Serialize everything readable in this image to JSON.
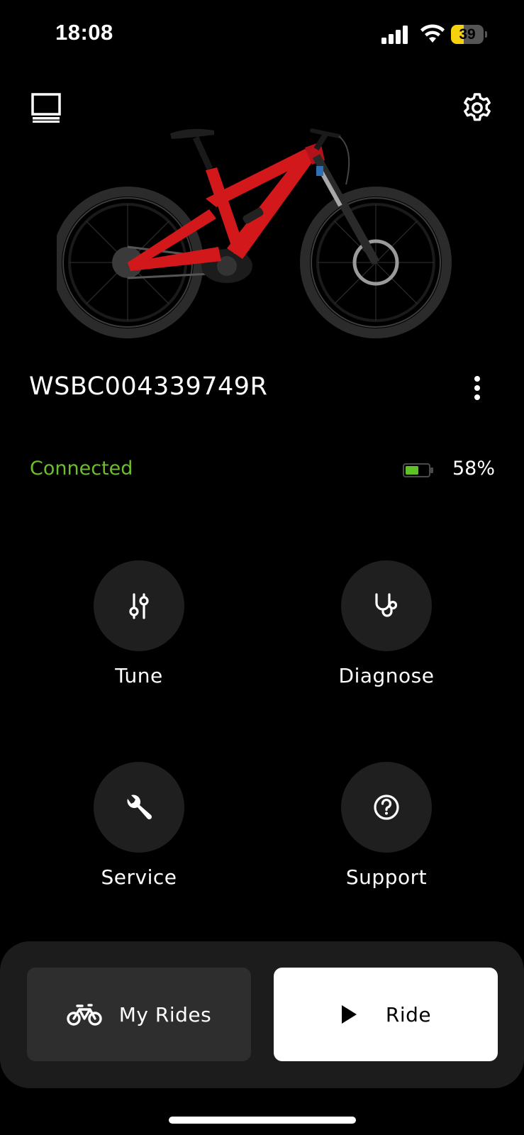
{
  "status_bar": {
    "time": "18:08",
    "battery_level": "39",
    "battery_fraction": 0.39,
    "icons": [
      "signal-icon",
      "wifi-icon",
      "battery-icon"
    ]
  },
  "header": {
    "left_icon": "garage-icon",
    "right_icon": "gear-icon"
  },
  "bike": {
    "name": "WSBC004339749R",
    "image": "red-mountain-bike",
    "brand_color": "#d3181c"
  },
  "connection": {
    "status": "Connected",
    "status_color": "#6ebd2c",
    "battery_percent_label": "58%",
    "battery_fraction": 0.58
  },
  "actions": [
    {
      "label": "Tune",
      "icon": "sliders-icon"
    },
    {
      "label": "Diagnose",
      "icon": "stethoscope-icon"
    },
    {
      "label": "Service",
      "icon": "wrench-icon"
    },
    {
      "label": "Support",
      "icon": "help-circle-icon"
    }
  ],
  "bottom_bar": {
    "my_rides_label": "My Rides",
    "my_rides_icon": "bicycle-icon",
    "ride_label": "Ride",
    "ride_icon": "play-icon"
  }
}
